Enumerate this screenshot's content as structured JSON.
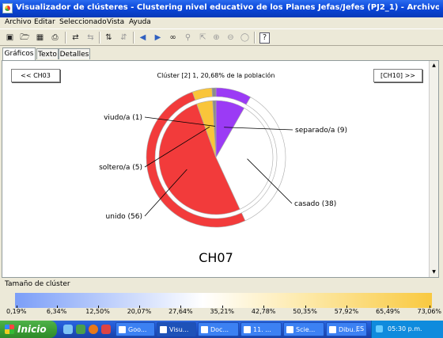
{
  "window": {
    "title": "Visualizador de clústeres - Clustering nivel educativo de los Planes Jefas/Jefes (PJ2_1) - Archivo local: general I..."
  },
  "menu": [
    "Archivo",
    "Editar",
    "Seleccionado",
    "Vista",
    "Ayuda"
  ],
  "toolbar": {
    "icons": [
      "new-icon",
      "open-icon",
      "save-icon",
      "print-icon",
      "swap-icon",
      "swap-alt-icon",
      "sort-icon",
      "sort-alt-icon",
      "arrow-left-icon",
      "arrow-right-icon",
      "binoculars-icon",
      "find-icon",
      "select-icon",
      "zoom-in-icon",
      "zoom-out-icon",
      "zoom-fit-icon",
      "help-icon"
    ]
  },
  "tabs": [
    {
      "label": "Gráficos",
      "active": true
    },
    {
      "label": "Texto",
      "active": false
    },
    {
      "label": "Detalles",
      "active": false
    }
  ],
  "nav": {
    "prev": "<< CH03",
    "next": "[CH10] >>"
  },
  "cluster_title": "Clúster [2] 1, 20,68% de la población",
  "chart_data": {
    "type": "pie",
    "title": "CH07",
    "slices": [
      {
        "label": "separado/a (9)",
        "value": 9,
        "color": "#9b3bf5"
      },
      {
        "label": "casado (38)",
        "value": 38,
        "color": "#ffffff"
      },
      {
        "label": "unido (56)",
        "value": 56,
        "color": "#f23b3b"
      },
      {
        "label": "soltero/a (5)",
        "value": 5,
        "color": "#f9c53a"
      },
      {
        "label": "viudo/a (1)",
        "value": 1,
        "color": "#8c8c8c"
      }
    ]
  },
  "size_scale": {
    "label": "Tamaño de clúster",
    "ticks": [
      "0,19%",
      "6,34%",
      "12,50%",
      "20,07%",
      "27,64%",
      "35,21%",
      "42,78%",
      "50,35%",
      "57,92%",
      "65,49%",
      "73,06%"
    ]
  },
  "taskbar": {
    "start": "Inicio",
    "tasks": [
      "Goo...",
      "Visu...",
      "Doc...",
      "11. ...",
      "Scie...",
      "Dibu..."
    ],
    "lang": "ES",
    "time": "05:30 p.m."
  }
}
